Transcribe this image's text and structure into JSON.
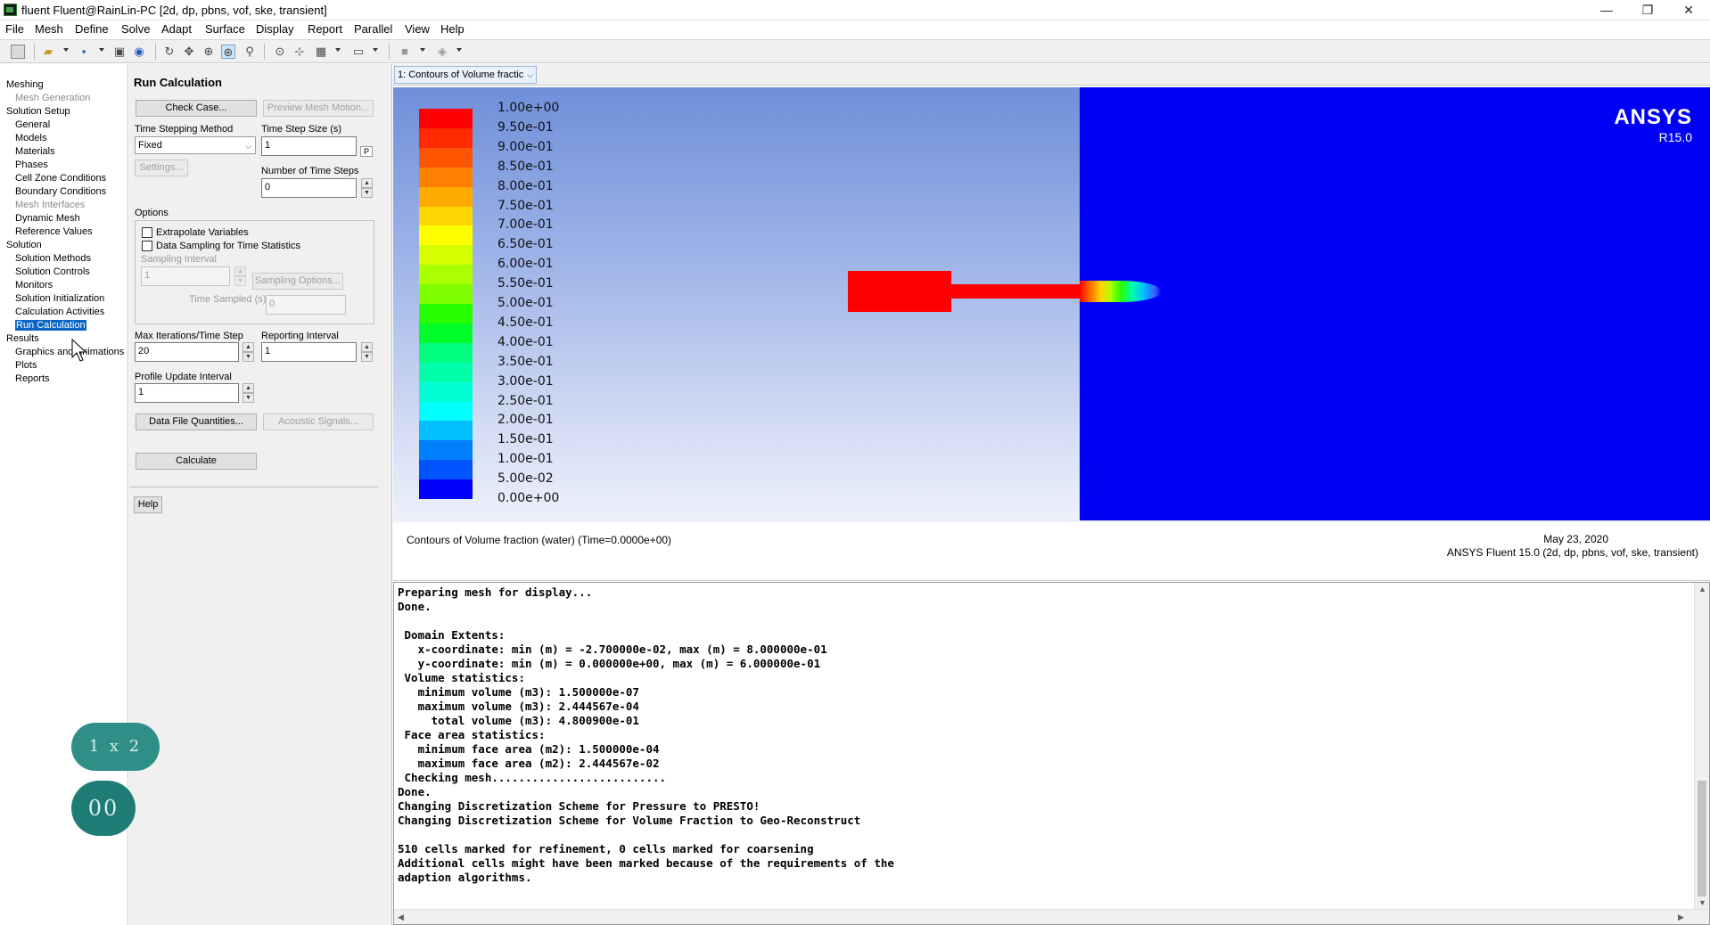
{
  "window": {
    "title": "fluent Fluent@RainLin-PC  [2d, dp, pbns, vof, ske, transient]",
    "controls": [
      "—",
      "❐",
      "✕"
    ]
  },
  "menubar": [
    "File",
    "Mesh",
    "Define",
    "Solve",
    "Adapt",
    "Surface",
    "Display",
    "Report",
    "Parallel",
    "View",
    "Help"
  ],
  "nav": {
    "items": [
      {
        "label": "Meshing",
        "level": 0,
        "state": "normal"
      },
      {
        "label": "Mesh Generation",
        "level": 1,
        "state": "dim"
      },
      {
        "label": "Solution Setup",
        "level": 0,
        "state": "normal"
      },
      {
        "label": "General",
        "level": 1,
        "state": "normal"
      },
      {
        "label": "Models",
        "level": 1,
        "state": "normal"
      },
      {
        "label": "Materials",
        "level": 1,
        "state": "normal"
      },
      {
        "label": "Phases",
        "level": 1,
        "state": "normal"
      },
      {
        "label": "Cell Zone Conditions",
        "level": 1,
        "state": "normal"
      },
      {
        "label": "Boundary Conditions",
        "level": 1,
        "state": "normal"
      },
      {
        "label": "Mesh Interfaces",
        "level": 1,
        "state": "dim"
      },
      {
        "label": "Dynamic Mesh",
        "level": 1,
        "state": "normal"
      },
      {
        "label": "Reference Values",
        "level": 1,
        "state": "normal"
      },
      {
        "label": "Solution",
        "level": 0,
        "state": "normal"
      },
      {
        "label": "Solution Methods",
        "level": 1,
        "state": "normal"
      },
      {
        "label": "Solution Controls",
        "level": 1,
        "state": "normal"
      },
      {
        "label": "Monitors",
        "level": 1,
        "state": "normal"
      },
      {
        "label": "Solution Initialization",
        "level": 1,
        "state": "normal"
      },
      {
        "label": "Calculation Activities",
        "level": 1,
        "state": "normal"
      },
      {
        "label": "Run Calculation",
        "level": 1,
        "state": "selected"
      },
      {
        "label": "Results",
        "level": 0,
        "state": "normal"
      },
      {
        "label": "Graphics and Animations",
        "level": 1,
        "state": "normal"
      },
      {
        "label": "Plots",
        "level": 1,
        "state": "normal"
      },
      {
        "label": "Reports",
        "level": 1,
        "state": "normal"
      }
    ]
  },
  "panel": {
    "title": "Run Calculation",
    "check_case": "Check Case...",
    "preview_mesh_motion": "Preview Mesh Motion...",
    "time_stepping_method_label": "Time Stepping Method",
    "time_stepping_method_value": "Fixed",
    "time_step_size_label": "Time Step Size (s)",
    "time_step_size_value": "1",
    "time_step_unit": "P",
    "settings": "Settings...",
    "num_time_steps_label": "Number of Time Steps",
    "num_time_steps_value": "0",
    "options_label": "Options",
    "extrapolate_variables": "Extrapolate Variables",
    "data_sampling": "Data Sampling for Time Statistics",
    "sampling_interval_label": "Sampling Interval",
    "sampling_interval_value": "1",
    "sampling_options": "Sampling Options...",
    "time_sampled_label": "Time Sampled (s)",
    "time_sampled_value": "0",
    "max_iterations_label": "Max Iterations/Time Step",
    "max_iterations_value": "20",
    "reporting_interval_label": "Reporting Interval",
    "reporting_interval_value": "1",
    "profile_update_label": "Profile Update Interval",
    "profile_update_value": "1",
    "data_file_quantities": "Data File Quantities...",
    "acoustic_signals": "Acoustic Signals...",
    "calculate": "Calculate",
    "help": "Help"
  },
  "graphics": {
    "tab_label": "1: Contours of Volume fractic",
    "logo_brand": "ANSYS",
    "logo_version": "R15.0",
    "caption_left": "Contours of Volume fraction (water)    (Time=0.0000e+00)",
    "caption_date": "May 23, 2020",
    "caption_product": "ANSYS Fluent 15.0 (2d, dp, pbns, vof, ske, transient)",
    "colorbar_labels": [
      "1.00e+00",
      "9.50e-01",
      "9.00e-01",
      "8.50e-01",
      "8.00e-01",
      "7.50e-01",
      "7.00e-01",
      "6.50e-01",
      "6.00e-01",
      "5.50e-01",
      "5.00e-01",
      "4.50e-01",
      "4.00e-01",
      "3.50e-01",
      "3.00e-01",
      "2.50e-01",
      "2.00e-01",
      "1.50e-01",
      "1.00e-01",
      "5.00e-02",
      "0.00e+00"
    ],
    "colorbar_colors": [
      "#ff0000",
      "#ff2a00",
      "#ff5500",
      "#ff8000",
      "#ffaa00",
      "#ffd500",
      "#ffff00",
      "#d5ff00",
      "#aaff00",
      "#80ff00",
      "#2aff00",
      "#00ff2a",
      "#00ff80",
      "#00ffaa",
      "#00ffd5",
      "#00ffff",
      "#00c0ff",
      "#0080ff",
      "#0055ff",
      "#0000ff"
    ],
    "domain_color": "#0000f4",
    "fluid_color": "#ff0000"
  },
  "console": {
    "lines": [
      "Preparing mesh for display...",
      "Done.",
      "",
      " Domain Extents:",
      "   x-coordinate: min (m) = -2.700000e-02, max (m) = 8.000000e-01",
      "   y-coordinate: min (m) = 0.000000e+00, max (m) = 6.000000e-01",
      " Volume statistics:",
      "   minimum volume (m3): 1.500000e-07",
      "   maximum volume (m3): 2.444567e-04",
      "     total volume (m3): 4.800900e-01",
      " Face area statistics:",
      "   minimum face area (m2): 1.500000e-04",
      "   maximum face area (m2): 2.444567e-02",
      " Checking mesh..........................",
      "Done.",
      "Changing Discretization Scheme for Pressure to PRESTO!",
      "Changing Discretization Scheme for Volume Fraction to Geo-Reconstruct",
      "",
      "510 cells marked for refinement, 0 cells marked for coarsening",
      "Additional cells might have been marked because of the requirements of the",
      "adaption algorithms."
    ]
  },
  "overlay": {
    "speed_label": "1 x 2",
    "counter_label": "00"
  }
}
